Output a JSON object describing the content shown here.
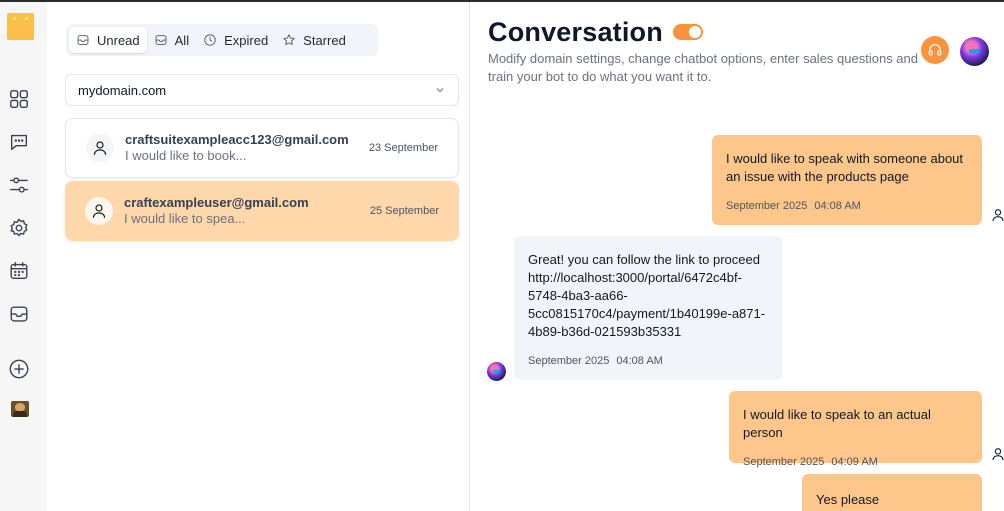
{
  "rail": {
    "items": [
      {
        "name": "dashboard-icon"
      },
      {
        "name": "chat-icon"
      },
      {
        "name": "sliders-icon"
      },
      {
        "name": "settings-icon"
      },
      {
        "name": "calendar-icon"
      },
      {
        "name": "mail-icon"
      },
      {
        "name": "add-icon"
      }
    ]
  },
  "inbox": {
    "tabs": [
      {
        "label": "Unread",
        "icon": "mail-icon",
        "active": true
      },
      {
        "label": "All",
        "icon": "mail-icon",
        "active": false
      },
      {
        "label": "Expired",
        "icon": "clock-icon",
        "active": false
      },
      {
        "label": "Starred",
        "icon": "star-icon",
        "active": false
      }
    ],
    "domain": {
      "selected": "mydomain.com"
    },
    "conversations": [
      {
        "email": "craftsuitexampleacc123@gmail.com",
        "preview": "I would like to book...",
        "date": "23 September",
        "selected": false
      },
      {
        "email": "craftexampleuser@gmail.com",
        "preview": "I would like to spea...",
        "date": "25 September",
        "selected": true
      }
    ]
  },
  "panel": {
    "title": "Conversation",
    "toggle_on": true,
    "subtitle": "Modify domain settings, change chatbot options, enter sales questions and train your bot to do what you want it to.",
    "messages": [
      {
        "role": "user",
        "lines": [
          "I would like to speak with someone about",
          "an issue with the products page"
        ],
        "date": "September 2025",
        "time": "04:08 AM"
      },
      {
        "role": "bot",
        "lines": [
          "Great! you can follow the link to proceed",
          "http://localhost:3000/portal/6472c4bf-",
          "5748-4ba3-aa66-",
          "5cc0815170c4/payment/1b40199e-a871-",
          "4b89-b36d-021593b35331"
        ],
        "date": "September 2025",
        "time": "04:08 AM"
      },
      {
        "role": "user",
        "lines": [
          "I would like to speak to an actual person"
        ],
        "date": "September 2025",
        "time": "04:09 AM"
      },
      {
        "role": "user",
        "lines": [
          "Yes please"
        ],
        "date": "",
        "time": ""
      }
    ]
  },
  "colors": {
    "accent": "#fb923c",
    "user_bubble": "#fdc68a",
    "bot_bubble": "#f1f5f9",
    "selected_card": "#fed7aa",
    "logo": "#fbbf4a"
  }
}
